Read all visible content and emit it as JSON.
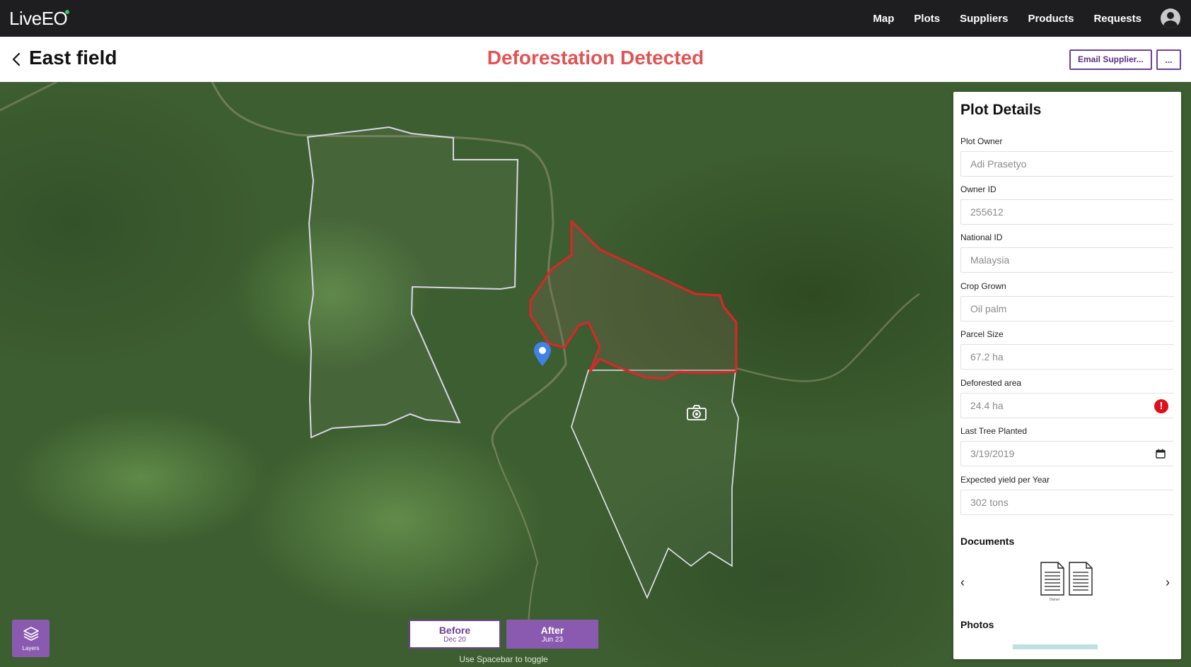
{
  "app": {
    "logo_text": "LiveEO",
    "brand_accent": "#3cc06a"
  },
  "nav": {
    "items": [
      "Map",
      "Plots",
      "Suppliers",
      "Products",
      "Requests"
    ]
  },
  "header": {
    "title": "East field",
    "status": "Deforestation Detected",
    "status_color": "#e25353",
    "email_button": "Email Supplier...",
    "more_button": "..."
  },
  "map": {
    "toggle": {
      "before_label": "Before",
      "before_date": "Dec 20",
      "after_label": "After",
      "after_date": "Jun 23",
      "hint": "Use Spacebar to toggle"
    },
    "layers_label": "Layers",
    "deforestation_outline_color": "#e0242b",
    "plot_outline_color": "#d9d6e8"
  },
  "panel": {
    "title": "Plot Details",
    "fields": [
      {
        "label": "Plot Owner",
        "value": "Adi Prasetyo"
      },
      {
        "label": "Owner ID",
        "value": "255612"
      },
      {
        "label": "National ID",
        "value": "Malaysia"
      },
      {
        "label": "Crop Grown",
        "value": "Oil palm"
      },
      {
        "label": "Parcel Size",
        "value": "67.2 ha"
      },
      {
        "label": "Deforested area",
        "value": "24.4 ha",
        "icon": "warning-icon"
      },
      {
        "label": "Last Tree Planted",
        "value": "3/19/2019",
        "icon": "calendar-icon"
      },
      {
        "label": "Expected yield per Year",
        "value": "302 tons"
      }
    ],
    "documents_title": "Documents",
    "document_caption": "Owner",
    "photos_title": "Photos",
    "accent": "#6e3f97"
  }
}
